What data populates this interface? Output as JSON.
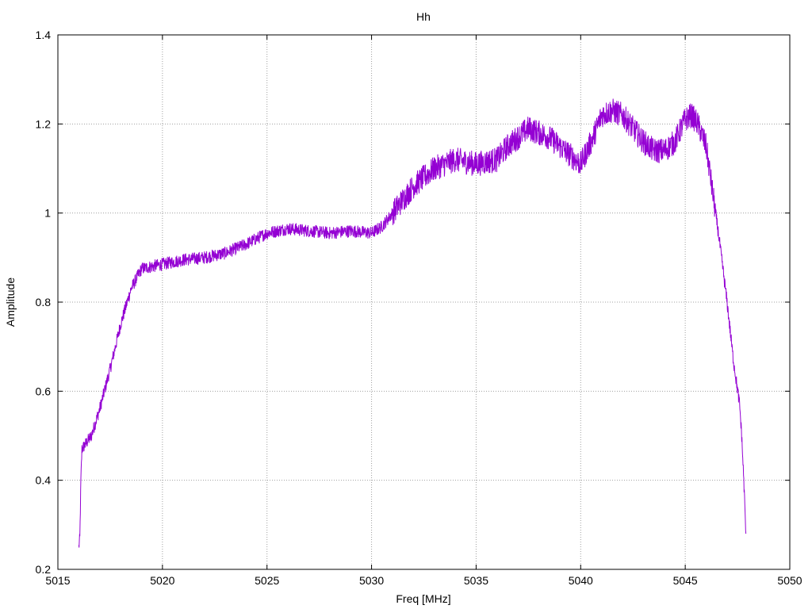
{
  "chart_data": {
    "type": "line",
    "title": "Hh",
    "xlabel": "Freq [MHz]",
    "ylabel": "Amplitude",
    "xlim": [
      5015,
      5050
    ],
    "ylim": [
      0.2,
      1.4
    ],
    "xticks": [
      5015,
      5020,
      5025,
      5030,
      5035,
      5040,
      5045,
      5050
    ],
    "xtick_labels": [
      "5015",
      "5020",
      "5025",
      "5030",
      "5035",
      "5040",
      "5045",
      "5050"
    ],
    "yticks": [
      0.2,
      0.4,
      0.6,
      0.8,
      1.0,
      1.2,
      1.4
    ],
    "ytick_labels": [
      "0.2",
      "0.4",
      "0.6",
      "0.8",
      "1",
      "1.2",
      "1.4"
    ],
    "grid": true,
    "series": [
      {
        "color": "#9400d3",
        "x": [
          5016.0,
          5016.05,
          5016.1,
          5016.15,
          5016.3,
          5016.6,
          5017.0,
          5017.5,
          5018.0,
          5018.5,
          5019.0,
          5020.0,
          5021.0,
          5022.0,
          5023.0,
          5024.0,
          5025.0,
          5026.0,
          5027.0,
          5028.0,
          5029.0,
          5030.0,
          5030.5,
          5031.0,
          5031.5,
          5032.0,
          5032.5,
          5033.0,
          5034.0,
          5035.0,
          5036.0,
          5036.5,
          5037.0,
          5037.5,
          5038.0,
          5038.5,
          5039.0,
          5039.5,
          5040.0,
          5040.3,
          5040.6,
          5041.0,
          5041.5,
          5042.0,
          5042.5,
          5043.0,
          5043.5,
          5044.0,
          5044.5,
          5045.0,
          5045.3,
          5045.6,
          5046.0,
          5046.3,
          5046.6,
          5047.0,
          5047.3,
          5047.6,
          5047.7,
          5047.8,
          5047.9
        ],
        "y": [
          0.25,
          0.27,
          0.4,
          0.47,
          0.48,
          0.5,
          0.56,
          0.65,
          0.75,
          0.83,
          0.875,
          0.885,
          0.895,
          0.9,
          0.91,
          0.93,
          0.955,
          0.965,
          0.96,
          0.955,
          0.96,
          0.955,
          0.97,
          1.0,
          1.03,
          1.06,
          1.08,
          1.1,
          1.12,
          1.11,
          1.12,
          1.15,
          1.17,
          1.19,
          1.18,
          1.17,
          1.15,
          1.13,
          1.11,
          1.14,
          1.17,
          1.22,
          1.23,
          1.22,
          1.19,
          1.16,
          1.14,
          1.14,
          1.16,
          1.21,
          1.22,
          1.2,
          1.15,
          1.05,
          0.95,
          0.8,
          0.67,
          0.57,
          0.5,
          0.4,
          0.28
        ]
      }
    ]
  }
}
